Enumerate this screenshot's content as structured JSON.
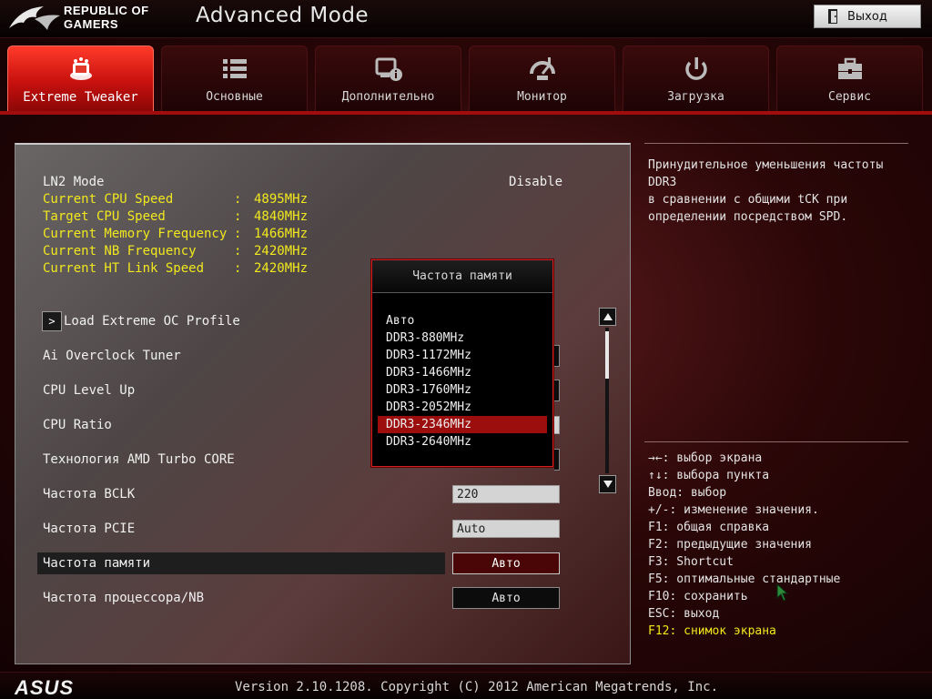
{
  "header": {
    "brand_line1": "REPUBLIC OF",
    "brand_line2": "GAMERS",
    "mode_title": "Advanced Mode",
    "exit_label": "Выход"
  },
  "tabs": [
    {
      "label": "Extreme Tweaker",
      "icon": "extreme-tweaker-icon",
      "active": true
    },
    {
      "label": "Основные",
      "icon": "list-icon",
      "active": false
    },
    {
      "label": "Дополнительно",
      "icon": "advanced-info-icon",
      "active": false
    },
    {
      "label": "Монитор",
      "icon": "monitor-gauge-icon",
      "active": false
    },
    {
      "label": "Загрузка",
      "icon": "power-icon",
      "active": false
    },
    {
      "label": "Сервис",
      "icon": "toolbox-icon",
      "active": false
    }
  ],
  "main": {
    "ln2": {
      "label": "LN2 Mode",
      "value": "Disable"
    },
    "info": [
      {
        "label": "Current CPU Speed",
        "value": "4895MHz"
      },
      {
        "label": "Target CPU Speed",
        "value": "4840MHz"
      },
      {
        "label": "Current Memory Frequency",
        "value": "1466MHz"
      },
      {
        "label": "Current NB Frequency",
        "value": "2420MHz"
      },
      {
        "label": "Current HT Link Speed",
        "value": "2420MHz"
      }
    ],
    "settings": {
      "load_profile": "Load Extreme OC Profile",
      "ai_tuner": "Ai Overclock Tuner",
      "cpu_level_up": "CPU Level Up",
      "cpu_ratio": "CPU Ratio",
      "turbo_core": "Технология AMD Turbo CORE",
      "bclk_label": "Частота BCLK",
      "bclk_value": "220",
      "pcie_label": "Частота PCIE",
      "pcie_value": "Auto",
      "mem_label": "Частота памяти",
      "mem_value": "Авто",
      "nb_label": "Частота процессора/NB",
      "nb_value": "Авто"
    }
  },
  "popup": {
    "title": "Частота памяти",
    "options": [
      "Авто",
      "DDR3-880MHz",
      "DDR3-1172MHz",
      "DDR3-1466MHz",
      "DDR3-1760MHz",
      "DDR3-2052MHz",
      "DDR3-2346MHz",
      "DDR3-2640MHz"
    ],
    "selected": "DDR3-2346MHz"
  },
  "help": {
    "line1": "Принудительное уменьшения частоты",
    "line2": "DDR3",
    "line3": "в сравнении с общими tCK при",
    "line4": "определении посредством SPD."
  },
  "keys": [
    "→←: выбор экрана",
    "↑↓: выбора пункта",
    "Ввод: выбор",
    "+/-: изменение значения.",
    "F1: общая справка",
    "F2: предыдущие значения",
    "F3: Shortcut",
    "F5: оптимальные стандартные",
    "F10: сохранить",
    "ESC: выход",
    "F12: снимок экрана"
  ],
  "colors": {
    "accent": "#c8110e",
    "info_text": "#f2e81e",
    "selected_item": "#9c0e0e"
  },
  "footer": {
    "version": "Version 2.10.1208. Copyright (C) 2012 American Megatrends, Inc."
  }
}
